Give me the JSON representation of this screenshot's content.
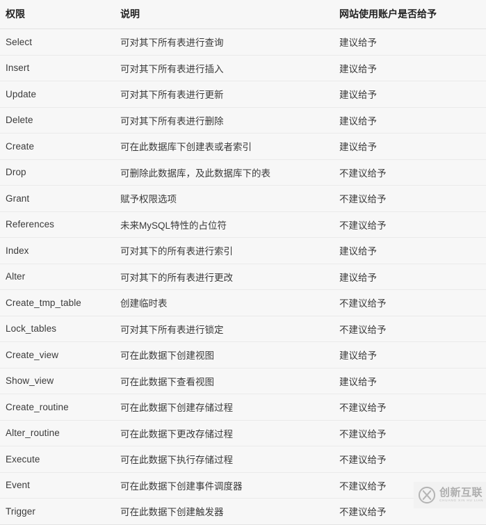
{
  "table": {
    "columns": [
      {
        "key": "name",
        "label": "权限"
      },
      {
        "key": "desc",
        "label": "说明"
      },
      {
        "key": "grant",
        "label": "网站使用账户是否给予"
      }
    ],
    "rows": [
      {
        "name": "Select",
        "desc": "可对其下所有表进行查询",
        "grant": "建议给予"
      },
      {
        "name": "Insert",
        "desc": "可对其下所有表进行插入",
        "grant": "建议给予"
      },
      {
        "name": "Update",
        "desc": "可对其下所有表进行更新",
        "grant": "建议给予"
      },
      {
        "name": "Delete",
        "desc": "可对其下所有表进行删除",
        "grant": "建议给予"
      },
      {
        "name": "Create",
        "desc": "可在此数据库下创建表或者索引",
        "grant": "建议给予"
      },
      {
        "name": "Drop",
        "desc": "可删除此数据库，及此数据库下的表",
        "grant": "不建议给予"
      },
      {
        "name": "Grant",
        "desc": "赋予权限选项",
        "grant": "不建议给予"
      },
      {
        "name": "References",
        "desc": "未来MySQL特性的占位符",
        "grant": "不建议给予"
      },
      {
        "name": "Index",
        "desc": "可对其下的所有表进行索引",
        "grant": "建议给予"
      },
      {
        "name": "Alter",
        "desc": "可对其下的所有表进行更改",
        "grant": "建议给予"
      },
      {
        "name": "Create_tmp_table",
        "desc": "创建临时表",
        "grant": "不建议给予"
      },
      {
        "name": "Lock_tables",
        "desc": "可对其下所有表进行锁定",
        "grant": "不建议给予"
      },
      {
        "name": "Create_view",
        "desc": "可在此数据下创建视图",
        "grant": "建议给予"
      },
      {
        "name": "Show_view",
        "desc": "可在此数据下查看视图",
        "grant": "建议给予"
      },
      {
        "name": "Create_routine",
        "desc": "可在此数据下创建存储过程",
        "grant": "不建议给予"
      },
      {
        "name": "Alter_routine",
        "desc": "可在此数据下更改存储过程",
        "grant": "不建议给予"
      },
      {
        "name": "Execute",
        "desc": "可在此数据下执行存储过程",
        "grant": "不建议给予"
      },
      {
        "name": "Event",
        "desc": "可在此数据下创建事件调度器",
        "grant": "不建议给予"
      },
      {
        "name": "Trigger",
        "desc": "可在此数据下创建触发器",
        "grant": "不建议给予"
      }
    ]
  },
  "watermark": {
    "logo_icon": "circle-x-logo-icon",
    "brand_cn": "创新互联",
    "brand_en": "CHUANG XIN HU LIAN"
  },
  "colors": {
    "page_background": "#f7f7f7",
    "row_border": "#eaeaea",
    "header_border": "#e2e2e2",
    "header_text": "#222222",
    "body_text": "#3a3a3a",
    "watermark_text": "#a8a8a8"
  }
}
